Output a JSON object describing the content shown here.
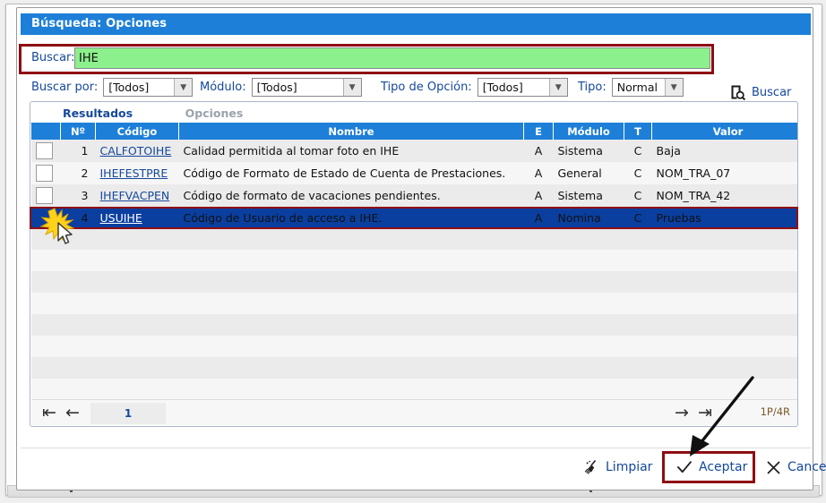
{
  "window": {
    "title": "Búsqueda: Opciones"
  },
  "search": {
    "label": "Buscar:",
    "value": "IHE",
    "placeholder": "",
    "button_label": "Buscar",
    "button_icon": "search-document-icon"
  },
  "filters": [
    {
      "label": "Buscar por:",
      "value": "[Todos]",
      "name": "buscar-por"
    },
    {
      "label": "Módulo:",
      "value": "[Todos]",
      "name": "modulo"
    },
    {
      "label": "Tipo de Opción:",
      "value": "[Todos]",
      "name": "tipo-de-opcion"
    },
    {
      "label": "Tipo:",
      "value": "Normal",
      "name": "tipo"
    }
  ],
  "tabs": [
    {
      "label": "Resultados",
      "active": true
    },
    {
      "label": "Opciones",
      "active": false
    }
  ],
  "table": {
    "columns": [
      "",
      "Nº",
      "Código",
      "Nombre",
      "E",
      "Módulo",
      "T",
      "Valor"
    ],
    "rows": [
      {
        "no": "1",
        "codigo": "CALFOTOIHE",
        "nombre": "Calidad permitida al tomar foto en IHE",
        "e": "A",
        "modulo": "Sistema",
        "t": "C",
        "valor": "Baja",
        "selected": false
      },
      {
        "no": "2",
        "codigo": "IHEFESTPRE",
        "nombre": "Código de Formato de Estado de Cuenta de Prestaciones.",
        "e": "A",
        "modulo": "General",
        "t": "C",
        "valor": "NOM_TRA_07",
        "selected": false
      },
      {
        "no": "3",
        "codigo": "IHEFVACPEN",
        "nombre": "Código de formato de vacaciones pendientes.",
        "e": "A",
        "modulo": "Sistema",
        "t": "C",
        "valor": "NOM_TRA_42",
        "selected": false
      },
      {
        "no": "4",
        "codigo": "USUIHE",
        "nombre": "Código de Usuario de acceso a IHE.",
        "e": "A",
        "modulo": "Nomina",
        "t": "C",
        "valor": "Pruebas",
        "selected": true
      }
    ],
    "empty_row_count": 8
  },
  "pager": {
    "first_icon": "first-page-icon",
    "prev_icon": "previous-page-icon",
    "next_icon": "next-page-icon",
    "last_icon": "last-page-icon",
    "page_value": "1",
    "info": "1P/4R"
  },
  "footer": {
    "buttons": [
      {
        "label": "Limpiar",
        "icon": "broom-icon",
        "highlighted": false
      },
      {
        "label": "Aceptar",
        "icon": "check-icon",
        "highlighted": true
      },
      {
        "label": "Cancelar",
        "icon": "close-x-icon",
        "highlighted": false
      }
    ]
  },
  "annotations": {
    "highlight_color": "#8e0d12",
    "accent_color": "#1d7fd8",
    "link_color": "#15489c",
    "search_field_color": "#8cf08c",
    "selected_row_color": "#0a3fa0",
    "arrow_pointer": "arrow-annotation",
    "click_marker": "click-burst-cursor"
  }
}
